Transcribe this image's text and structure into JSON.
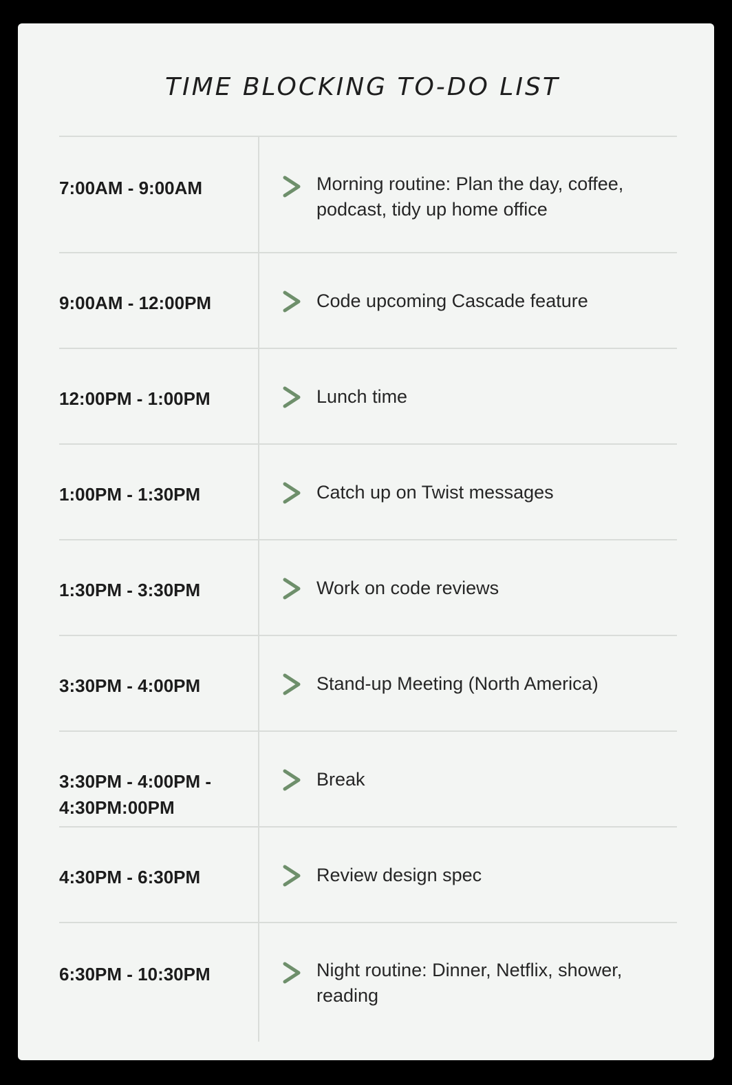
{
  "title": "TIME BLOCKING TO-DO LIST",
  "colors": {
    "background": "#f3f5f3",
    "arrow": "#6e8f6b",
    "rule": "#d9dcd9",
    "text": "#1c1c1c"
  },
  "rows": [
    {
      "time": "7:00AM - 9:00AM",
      "icon": "chevron-right-icon",
      "task": "Morning routine: Plan the day, coffee, podcast, tidy up home office"
    },
    {
      "time": "9:00AM - 12:00PM",
      "icon": "chevron-right-icon",
      "task": "Code upcoming Cascade feature"
    },
    {
      "time": "12:00PM - 1:00PM",
      "icon": "chevron-right-icon",
      "task": "Lunch time"
    },
    {
      "time": "1:00PM - 1:30PM",
      "icon": "chevron-right-icon",
      "task": "Catch up on Twist messages"
    },
    {
      "time": "1:30PM - 3:30PM",
      "icon": "chevron-right-icon",
      "task": "Work on code reviews"
    },
    {
      "time": "3:30PM - 4:00PM",
      "icon": "chevron-right-icon",
      "task": "Stand-up Meeting (North America)"
    },
    {
      "time": "3:30PM - 4:00PM -\n4:30PM:00PM",
      "icon": "chevron-right-icon",
      "task": "Break"
    },
    {
      "time": "4:30PM - 6:30PM",
      "icon": "chevron-right-icon",
      "task": "Review design spec"
    },
    {
      "time": "6:30PM - 10:30PM",
      "icon": "chevron-right-icon",
      "task": "Night routine: Dinner, Netflix, shower, reading"
    }
  ]
}
